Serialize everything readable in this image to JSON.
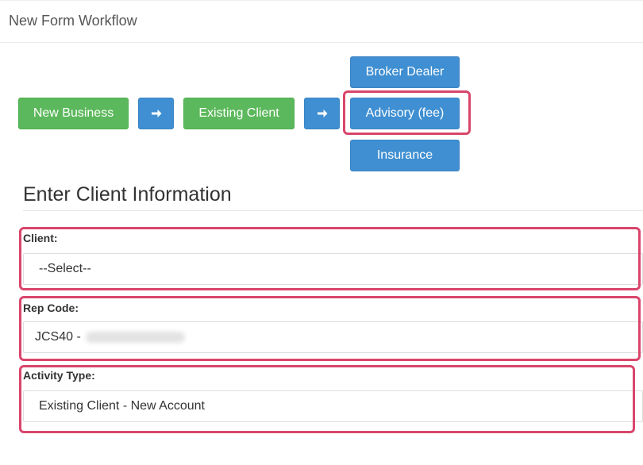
{
  "header": {
    "title": "New Form Workflow"
  },
  "workflow": {
    "step1_label": "New Business",
    "step2_label": "Existing Client",
    "options": {
      "broker_dealer": "Broker Dealer",
      "advisory": "Advisory (fee)",
      "insurance": "Insurance"
    },
    "selected_option": "Advisory (fee)",
    "arrow_icon": "arrow-right-icon"
  },
  "section": {
    "title": "Enter Client Information"
  },
  "fields": {
    "client": {
      "label": "Client:",
      "value": "--Select--"
    },
    "rep_code": {
      "label": "Rep Code:",
      "value": "JCS40 -"
    },
    "activity_type": {
      "label": "Activity Type:",
      "value": "Existing Client - New Account"
    }
  },
  "colors": {
    "green_button": "#5cb85c",
    "blue_button": "#3f8fd2",
    "highlight": "#d9466b"
  }
}
